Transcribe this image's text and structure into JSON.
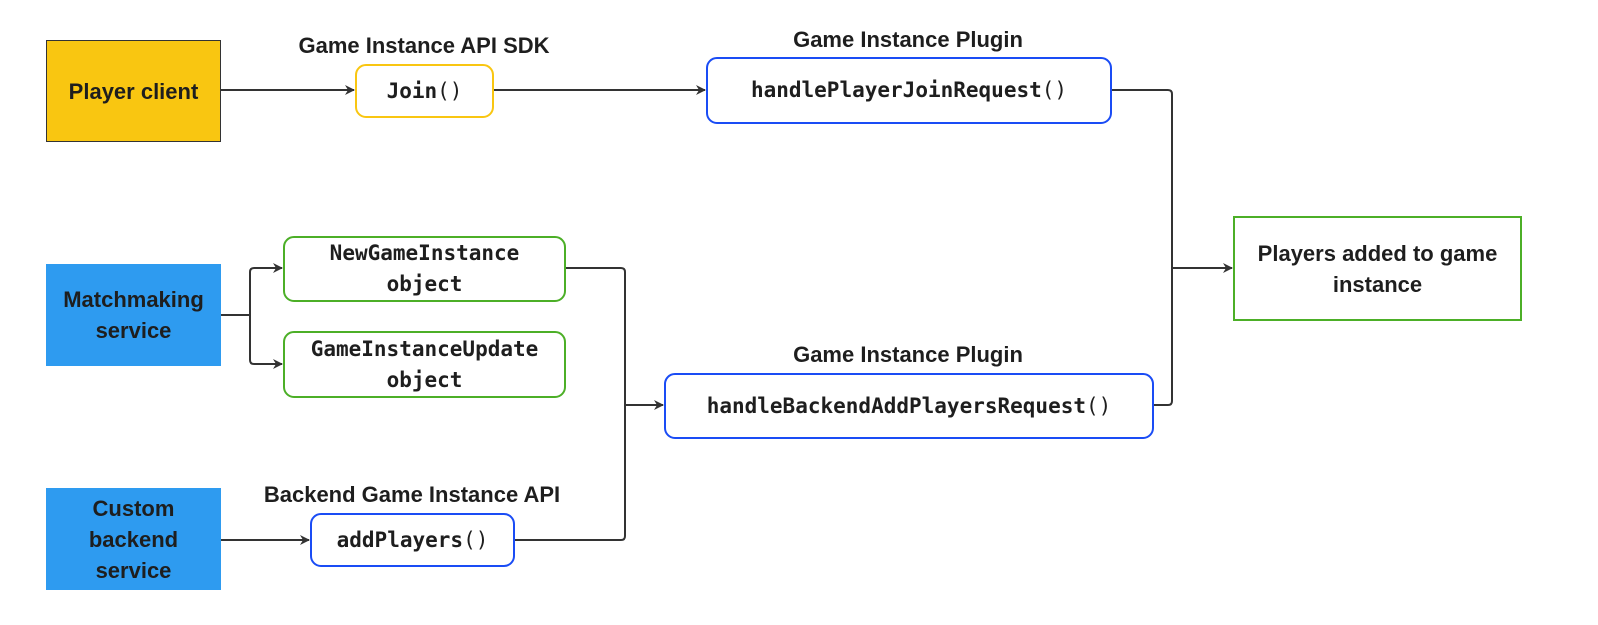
{
  "colors": {
    "yellow": "#F9C611",
    "blue_fill": "#2E9BF0",
    "blue_border": "#1A4CF5",
    "green": "#4CAF27",
    "line": "#333333"
  },
  "sources": {
    "player_client": "Player client",
    "matchmaking": "Matchmaking service",
    "custom_backend": "Custom backend service"
  },
  "labels": {
    "sdk": "Game Instance API SDK",
    "plugin_top": "Game Instance Plugin",
    "plugin_bottom": "Game Instance Plugin",
    "backend_api": "Backend Game Instance API"
  },
  "nodes": {
    "join": {
      "name": "Join",
      "parens": "()"
    },
    "handle_join": {
      "name": "handlePlayerJoinRequest",
      "parens": "()"
    },
    "new_game_instance": {
      "line1": "NewGameInstance",
      "line2": "object"
    },
    "game_instance_update": {
      "line1": "GameInstanceUpdate",
      "line2": "object"
    },
    "handle_backend": {
      "name": "handleBackendAddPlayersRequest",
      "parens": "()"
    },
    "add_players": {
      "name": "addPlayers",
      "parens": "()"
    }
  },
  "result": "Players added to game instance"
}
